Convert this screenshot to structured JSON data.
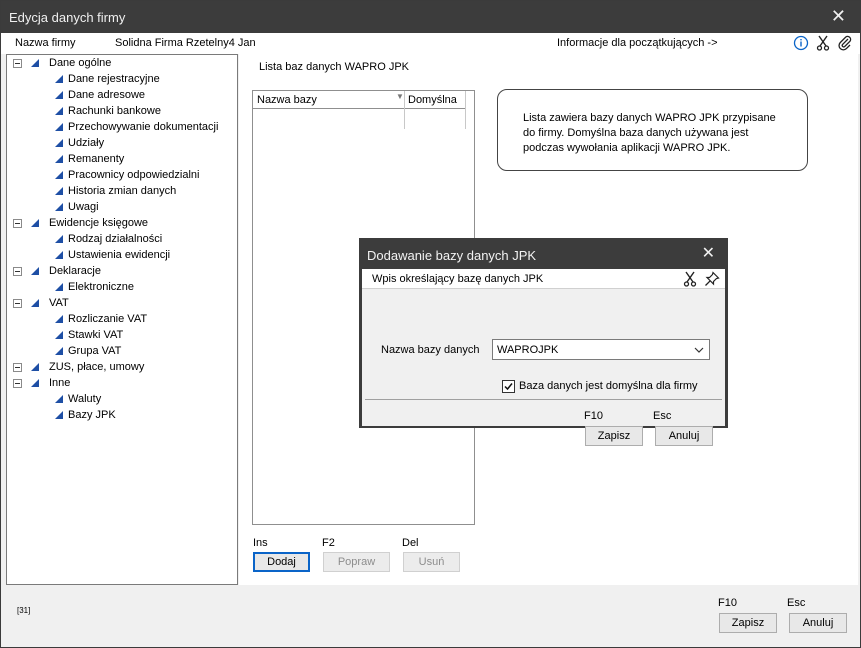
{
  "window": {
    "title": "Edycja danych firmy",
    "close_glyph": "✕"
  },
  "infobar": {
    "firm_label": "Nazwa firmy",
    "firm_value": "Solidna Firma Rzetelny4 Jan",
    "beginners_link": "Informacje dla początkujących ->",
    "icons": [
      "info-icon",
      "scissors-icon",
      "paperclip-icon"
    ]
  },
  "tree": {
    "groups": [
      {
        "label": "Dane ogólne",
        "children": [
          "Dane rejestracyjne",
          "Dane adresowe",
          "Rachunki bankowe",
          "Przechowywanie dokumentacji",
          "Udziały",
          "Remanenty",
          "Pracownicy odpowiedzialni",
          "Historia zmian danych",
          "Uwagi"
        ]
      },
      {
        "label": "Ewidencje księgowe",
        "children": [
          "Rodzaj działalności",
          "Ustawienia ewidencji"
        ]
      },
      {
        "label": "Deklaracje",
        "children": [
          "Elektroniczne"
        ]
      },
      {
        "label": "VAT",
        "children": [
          "Rozliczanie VAT",
          "Stawki VAT",
          "Grupa VAT"
        ]
      },
      {
        "label": "ZUS, płace, umowy",
        "children": []
      },
      {
        "label": "Inne",
        "children": [
          "Waluty",
          "Bazy JPK"
        ]
      }
    ]
  },
  "main": {
    "list_title": "Lista baz danych WAPRO JPK",
    "columns": [
      "Nazwa bazy",
      "Domyślna"
    ],
    "info_text": "Lista zawiera bazy danych WAPRO JPK przypisane do firmy. Domyślna baza danych używana jest podczas wywołania aplikacji WAPRO JPK.",
    "buttons": [
      {
        "key": "Ins",
        "label": "Dodaj",
        "enabled": true
      },
      {
        "key": "F2",
        "label": "Popraw",
        "enabled": false
      },
      {
        "key": "Del",
        "label": "Usuń",
        "enabled": false
      }
    ]
  },
  "footer": {
    "code": "[31]",
    "save_key": "F10",
    "save_label": "Zapisz",
    "cancel_key": "Esc",
    "cancel_label": "Anuluj"
  },
  "dialog": {
    "title": "Dodawanie bazy danych JPK",
    "close_glyph": "✕",
    "subtitle": "Wpis określający bazę danych JPK",
    "field_label": "Nazwa bazy danych",
    "field_value": "WAPROJPK",
    "checkbox_label": "Baza danych jest domyślna dla firmy",
    "checkbox_checked": true,
    "save_key": "F10",
    "save_label": "Zapisz",
    "cancel_key": "Esc",
    "cancel_label": "Anuluj"
  },
  "colors": {
    "titlebar": "#3c3c3c",
    "accent_blue": "#0a64c8",
    "tree_triangle": "#1e4fa5"
  }
}
